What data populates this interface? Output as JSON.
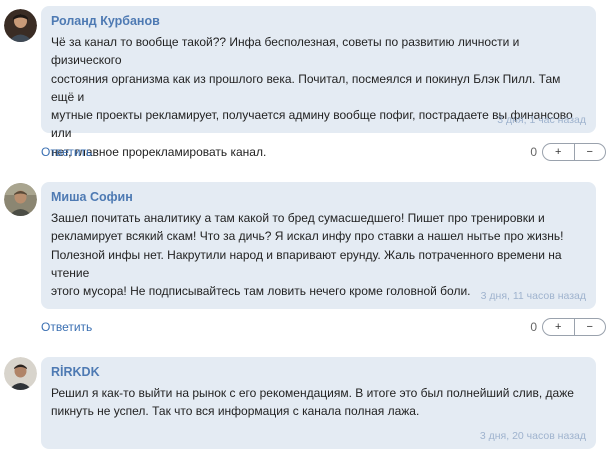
{
  "comments": [
    {
      "author": "Роланд Курбанов",
      "text": "Чё за канал то вообще такой?? Инфа бесполезная, советы по развитию личности и физического\nсостояния организма как из прошлого века. Почитал, посмеялся и покинул Блэк Пилл. Там ещё и\nмутные проекты рекламирует, получается админу вообще пофиг, пострадаете вы финансово или\nнет, главное прорекламировать канал.",
      "time": "3 дня, 1 час назад",
      "reply_label": "Ответить",
      "score": "0",
      "upvote": "+",
      "downvote": "−"
    },
    {
      "author": "Миша Софин",
      "text": "Зашел почитать аналитику а там какой то бред сумасшедшего! Пишет про тренировки и\nрекламирует всякий скам! Что за дичь? Я искал инфу про ставки а нашел нытье про жизнь!\nПолезной инфы нет. Накрутили народ и впаривают ерунду. Жаль потраченного времени на чтение\nэтого мусора! Не подписывайтесь там ловить нечего кроме головной боли.",
      "time": "3 дня, 11 часов назад",
      "reply_label": "Ответить",
      "score": "0",
      "upvote": "+",
      "downvote": "−"
    },
    {
      "author": "RİRKDK",
      "text": "Решил я как-то выйти на рынок с его рекомендациям. В итоге это был полнейший слив, даже\nпикнуть не успел. Так что вся информация с канала полная лажа.",
      "time": "3 дня, 20 часов назад"
    }
  ]
}
